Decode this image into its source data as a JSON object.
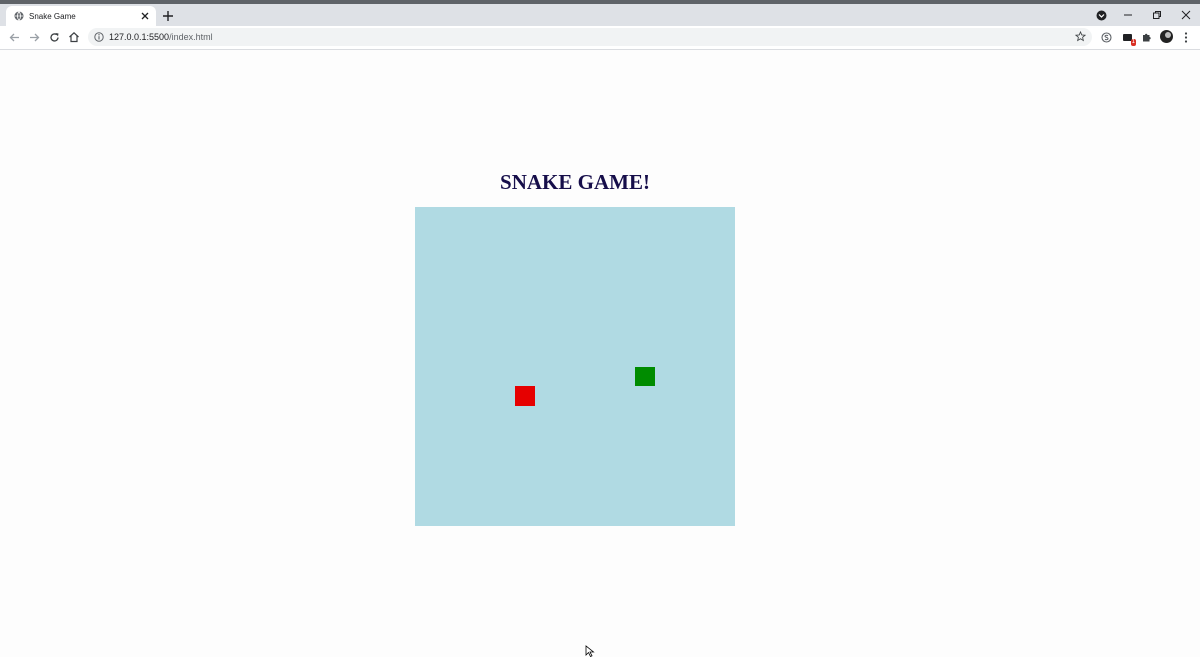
{
  "browser": {
    "tab_title": "Snake Game",
    "url_host": "127.0.0.1:5500",
    "url_path": "/index.html",
    "extension_badge": "1"
  },
  "page": {
    "title": "SNAKE GAME!"
  },
  "game": {
    "grid": {
      "cols": 16,
      "rows": 16
    },
    "snake": [
      {
        "col": 11,
        "row": 8
      }
    ],
    "food": {
      "col": 5,
      "row": 9
    },
    "colors": {
      "board": "#b0dae3",
      "snake": "#008c00",
      "food": "#e60000",
      "title": "#160e4a"
    }
  }
}
